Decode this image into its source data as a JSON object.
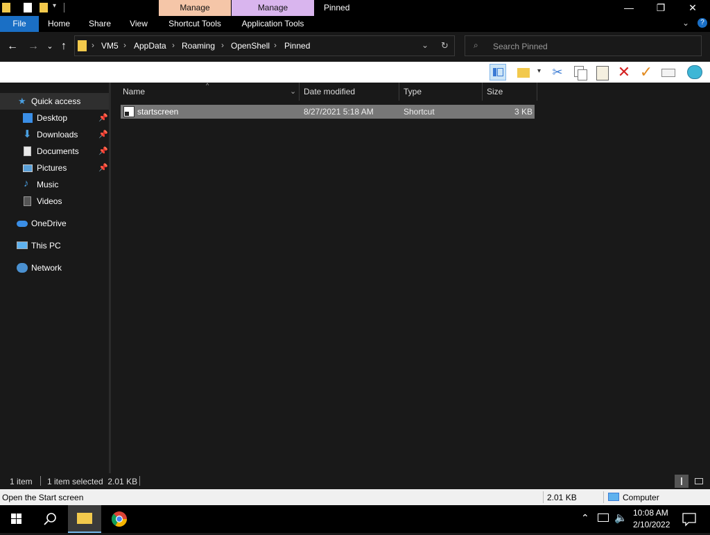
{
  "titlebar": {
    "context_tab_1": "Manage",
    "context_tab_2": "Manage",
    "window_title": "Pinned",
    "colors": {
      "context_tab_1": "#f5c6a8",
      "context_tab_2": "#d9b5ee"
    }
  },
  "ribbon": {
    "tabs": [
      "File",
      "Home",
      "Share",
      "View",
      "Shortcut Tools",
      "Application Tools"
    ],
    "file_tab_color": "#1a6fc5"
  },
  "address": {
    "crumbs": [
      "VM5",
      "AppData",
      "Roaming",
      "OpenShell",
      "Pinned"
    ],
    "search_placeholder": "Search Pinned"
  },
  "nav": {
    "quick_access": "Quick access",
    "items": [
      {
        "label": "Desktop",
        "icon": "desktop-icon",
        "pinned": true
      },
      {
        "label": "Downloads",
        "icon": "downloads-icon",
        "pinned": true
      },
      {
        "label": "Documents",
        "icon": "documents-icon",
        "pinned": true
      },
      {
        "label": "Pictures",
        "icon": "pictures-icon",
        "pinned": true
      },
      {
        "label": "Music",
        "icon": "music-icon",
        "pinned": false
      },
      {
        "label": "Videos",
        "icon": "videos-icon",
        "pinned": false
      }
    ],
    "onedrive": "OneDrive",
    "thispc": "This PC",
    "network": "Network"
  },
  "columns": {
    "name": "Name",
    "date": "Date modified",
    "type": "Type",
    "size": "Size"
  },
  "files": [
    {
      "name": "startscreen",
      "date": "8/27/2021 5:18 AM",
      "type": "Shortcut",
      "size": "3 KB",
      "selected": true
    }
  ],
  "status": {
    "count": "1 item",
    "selected": "1 item selected  2.01 KB"
  },
  "infobar": {
    "tip": "Open the Start screen",
    "size": "2.01 KB",
    "location": "Computer"
  },
  "taskbar": {
    "time": "10:08 AM",
    "date": "2/10/2022"
  }
}
